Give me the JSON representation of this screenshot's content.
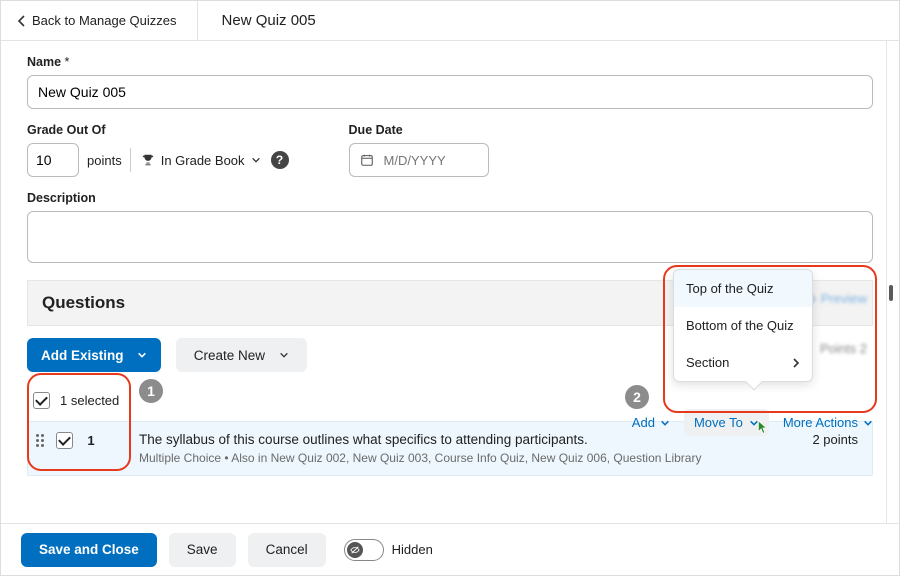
{
  "header": {
    "back": "Back to Manage Quizzes",
    "title": "New Quiz 005"
  },
  "fields": {
    "name_label": "Name",
    "name_value": "New Quiz 005",
    "grade_label": "Grade Out Of",
    "grade_value": "10",
    "points_label": "points",
    "gradebook": "In Grade Book",
    "due_label": "Due Date",
    "due_placeholder": "M/D/YYYY",
    "desc_label": "Description"
  },
  "questions": {
    "heading": "Questions",
    "add_existing": "Add Existing",
    "create_new": "Create New",
    "preview": "Preview",
    "total_points": "Points 2",
    "selected_label": "1 selected",
    "row": {
      "num": "1",
      "title": "The syllabus of this course outlines what specifics to attending participants.",
      "meta": "Multiple Choice   •   Also in New Quiz 002, New Quiz 003, Course Info Quiz, New Quiz 006, Question Library",
      "points": "2 points"
    },
    "actions": {
      "add": "Add",
      "move_to": "Move To",
      "more": "More Actions"
    },
    "dropdown": {
      "top": "Top of the Quiz",
      "bottom": "Bottom of the Quiz",
      "section": "Section"
    }
  },
  "footer": {
    "save_close": "Save and Close",
    "save": "Save",
    "cancel": "Cancel",
    "hidden": "Hidden"
  },
  "annotations": {
    "one": "1",
    "two": "2"
  }
}
